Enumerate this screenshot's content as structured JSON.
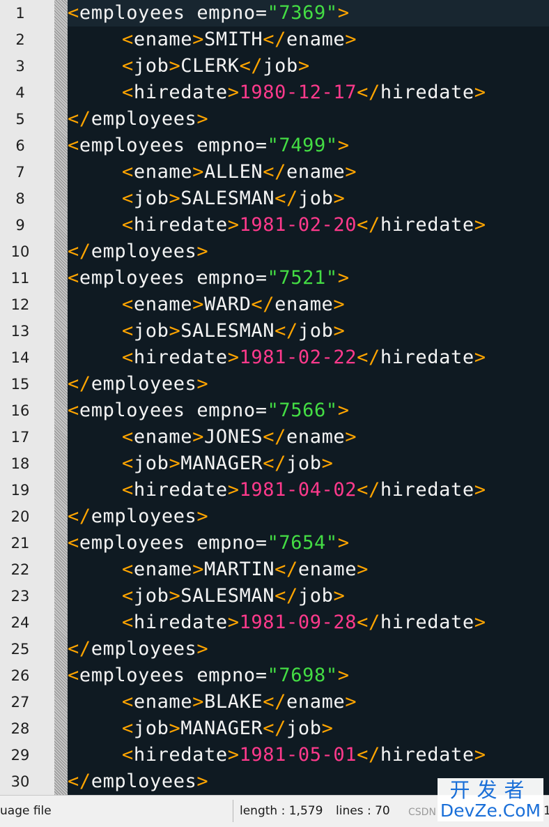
{
  "editor": {
    "line_numbers": [
      "1",
      "2",
      "3",
      "4",
      "5",
      "6",
      "7",
      "8",
      "9",
      "10",
      "11",
      "12",
      "13",
      "14",
      "15",
      "16",
      "17",
      "18",
      "19",
      "20",
      "21",
      "22",
      "23",
      "24",
      "25",
      "26",
      "27",
      "28",
      "29",
      "30"
    ],
    "records": [
      {
        "empno": "7369",
        "ename": "SMITH",
        "job": "CLERK",
        "hiredate": "1980-12-17"
      },
      {
        "empno": "7499",
        "ename": "ALLEN",
        "job": "SALESMAN",
        "hiredate": "1981-02-20"
      },
      {
        "empno": "7521",
        "ename": "WARD",
        "job": "SALESMAN",
        "hiredate": "1981-02-22"
      },
      {
        "empno": "7566",
        "ename": "JONES",
        "job": "MANAGER",
        "hiredate": "1981-04-02"
      },
      {
        "empno": "7654",
        "ename": "MARTIN",
        "job": "SALESMAN",
        "hiredate": "1981-09-28"
      },
      {
        "empno": "7698",
        "ename": "BLAKE",
        "job": "MANAGER",
        "hiredate": "1981-05-01"
      }
    ],
    "tags": {
      "root": "employees",
      "attr": "empno",
      "name": "ename",
      "job": "job",
      "date": "hiredate"
    },
    "colors": {
      "background": "#0f1a22",
      "bracket": "#ffa500",
      "text": "#f4f4f4",
      "string": "#44dd44",
      "date_value": "#ff3a8c",
      "gutter": "#e8e8e8"
    }
  },
  "statusbar": {
    "file_type": "uage file",
    "length": "length : 1,579",
    "lines": "lines : 70",
    "right_fragment": "1"
  },
  "watermark": {
    "line1": "开发者",
    "line2": "DevZe.CoM",
    "csdn": "CSDN"
  }
}
